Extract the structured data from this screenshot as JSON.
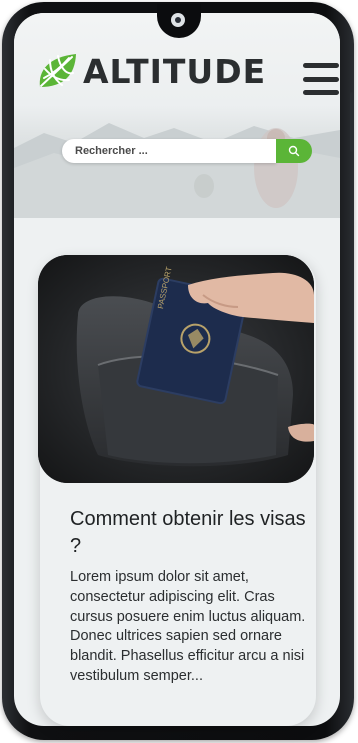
{
  "header": {
    "brand": "ALTITUDE",
    "logo_icon": "leaf-globe-icon",
    "menu_icon": "hamburger-menu-icon"
  },
  "search": {
    "placeholder": "Rechercher ...",
    "button_icon": "search-icon"
  },
  "article": {
    "image": "passport-in-backpack-photo",
    "title": "Comment obtenir les visas ?",
    "excerpt": "Lorem ipsum dolor sit amet, consectetur adipiscing elit. Cras cursus posuere enim luctus aliquam. Donec ultrices sapien sed ornare blandit. Phasellus efficitur arcu a nisi vestibulum semper..."
  },
  "colors": {
    "accent": "#5bb537",
    "text": "#2b2e30",
    "background": "#eef1f2",
    "phone_frame": "#0c0d0f"
  }
}
